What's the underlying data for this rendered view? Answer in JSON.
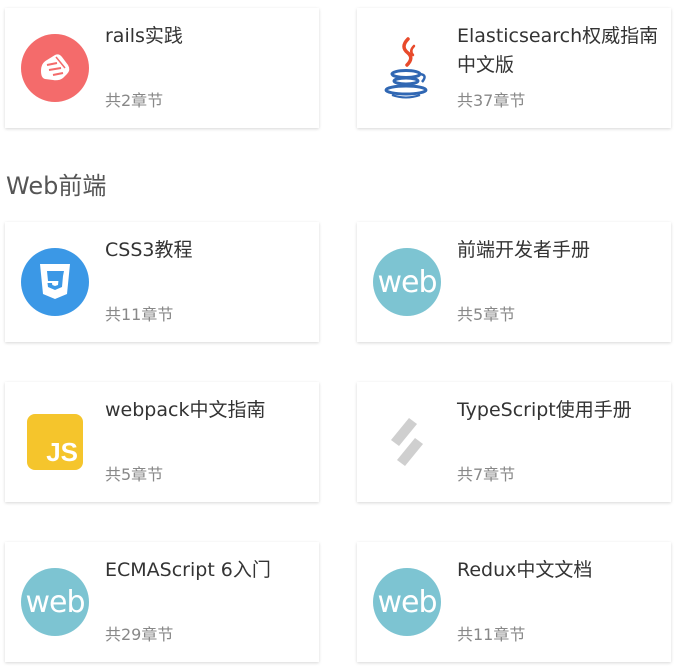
{
  "section": {
    "title": "Web前端"
  },
  "cards": [
    {
      "title": "rails实践",
      "count": "共2章节",
      "icon": "rails-shoe-icon",
      "color": "#f46b6b"
    },
    {
      "title": "Elasticsearch权威指南中文版",
      "count": "共37章节",
      "icon": "java-coffee-icon",
      "color": "#e84a2b"
    },
    {
      "title": "CSS3教程",
      "count": "共11章节",
      "icon": "css3-shield-icon",
      "color": "#3b98e6"
    },
    {
      "title": "前端开发者手册",
      "count": "共5章节",
      "icon": "web-badge-icon",
      "logo_text": "web",
      "color": "#7dc4d2"
    },
    {
      "title": "webpack中文指南",
      "count": "共5章节",
      "icon": "javascript-js-icon",
      "logo_text": "JS",
      "color": "#f5c52c"
    },
    {
      "title": "TypeScript使用手册",
      "count": "共7章节",
      "icon": "typescript-slash-icon",
      "color": "#cfcfcf"
    },
    {
      "title": "ECMAScript 6入门",
      "count": "共29章节",
      "icon": "web-badge-icon",
      "logo_text": "web",
      "color": "#7dc4d2"
    },
    {
      "title": "Redux中文文档",
      "count": "共11章节",
      "icon": "web-badge-icon",
      "logo_text": "web",
      "color": "#7dc4d2"
    }
  ]
}
